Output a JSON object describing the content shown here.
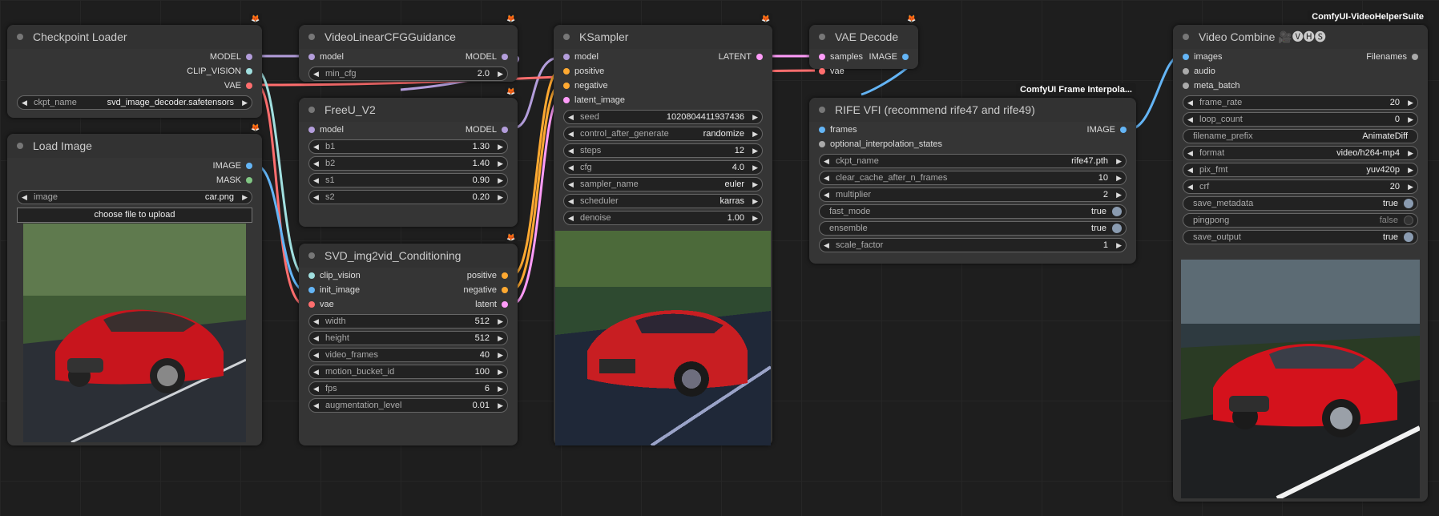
{
  "colors": {
    "model": "#b39ddb",
    "clip_vision": "#a1e0e0",
    "vae": "#ff6e6e",
    "image": "#64b5f6",
    "mask": "#81c784",
    "latent": "#ff9cf9",
    "conditioning": "#ffa931",
    "generic": "#aaaaaa",
    "badge_icon": "fox-icon"
  },
  "checkpoint_loader": {
    "title": "Checkpoint Loader",
    "outputs": [
      "MODEL",
      "CLIP_VISION",
      "VAE"
    ],
    "ckpt_name_label": "ckpt_name",
    "ckpt_name_value": "svd_image_decoder.safetensors"
  },
  "load_image": {
    "title": "Load Image",
    "outputs": [
      "IMAGE",
      "MASK"
    ],
    "image_label": "image",
    "image_value": "car.png",
    "upload_label": "choose file to upload"
  },
  "cfg_guidance": {
    "title": "VideoLinearCFGGuidance",
    "input": "model",
    "output": "MODEL",
    "min_cfg_label": "min_cfg",
    "min_cfg_value": "2.0"
  },
  "freeu": {
    "title": "FreeU_V2",
    "input": "model",
    "output": "MODEL",
    "widgets": [
      {
        "label": "b1",
        "value": "1.30"
      },
      {
        "label": "b2",
        "value": "1.40"
      },
      {
        "label": "s1",
        "value": "0.90"
      },
      {
        "label": "s2",
        "value": "0.20"
      }
    ]
  },
  "svd_cond": {
    "title": "SVD_img2vid_Conditioning",
    "inputs": [
      "clip_vision",
      "init_image",
      "vae"
    ],
    "outputs": [
      "positive",
      "negative",
      "latent"
    ],
    "widgets": [
      {
        "label": "width",
        "value": "512"
      },
      {
        "label": "height",
        "value": "512"
      },
      {
        "label": "video_frames",
        "value": "40"
      },
      {
        "label": "motion_bucket_id",
        "value": "100"
      },
      {
        "label": "fps",
        "value": "6"
      },
      {
        "label": "augmentation_level",
        "value": "0.01"
      }
    ]
  },
  "ksampler": {
    "title": "KSampler",
    "inputs": [
      "model",
      "positive",
      "negative",
      "latent_image"
    ],
    "output": "LATENT",
    "widgets": [
      {
        "label": "seed",
        "value": "1020804411937436"
      },
      {
        "label": "control_after_generate",
        "value": "randomize"
      },
      {
        "label": "steps",
        "value": "12"
      },
      {
        "label": "cfg",
        "value": "4.0"
      },
      {
        "label": "sampler_name",
        "value": "euler"
      },
      {
        "label": "scheduler",
        "value": "karras"
      },
      {
        "label": "denoise",
        "value": "1.00"
      }
    ]
  },
  "vae_decode": {
    "title": "VAE Decode",
    "inputs": [
      "samples",
      "vae"
    ],
    "output": "IMAGE"
  },
  "rife": {
    "group": "ComfyUI Frame Interpola...",
    "title": "RIFE VFI (recommend rife47 and rife49)",
    "inputs": [
      "frames",
      "optional_interpolation_states"
    ],
    "output": "IMAGE",
    "widgets": [
      {
        "label": "ckpt_name",
        "value": "rife47.pth",
        "kind": "combo"
      },
      {
        "label": "clear_cache_after_n_frames",
        "value": "10",
        "kind": "combo"
      },
      {
        "label": "multiplier",
        "value": "2",
        "kind": "combo"
      },
      {
        "label": "fast_mode",
        "value": "true",
        "kind": "toggle"
      },
      {
        "label": "ensemble",
        "value": "true",
        "kind": "toggle"
      },
      {
        "label": "scale_factor",
        "value": "1",
        "kind": "combo"
      }
    ]
  },
  "video_combine": {
    "group": "ComfyUI-VideoHelperSuite",
    "title": "Video Combine 🎥🅥🅗🅢",
    "inputs": [
      "images",
      "audio",
      "meta_batch"
    ],
    "output": "Filenames",
    "widgets": [
      {
        "label": "frame_rate",
        "value": "20",
        "kind": "combo"
      },
      {
        "label": "loop_count",
        "value": "0",
        "kind": "combo"
      },
      {
        "label": "filename_prefix",
        "value": "AnimateDiff",
        "kind": "plain"
      },
      {
        "label": "format",
        "value": "video/h264-mp4",
        "kind": "combo"
      },
      {
        "label": "pix_fmt",
        "value": "yuv420p",
        "kind": "combo"
      },
      {
        "label": "crf",
        "value": "20",
        "kind": "combo"
      },
      {
        "label": "save_metadata",
        "value": "true",
        "kind": "toggle"
      },
      {
        "label": "pingpong",
        "value": "false",
        "kind": "toggle"
      },
      {
        "label": "save_output",
        "value": "true",
        "kind": "toggle"
      }
    ]
  }
}
